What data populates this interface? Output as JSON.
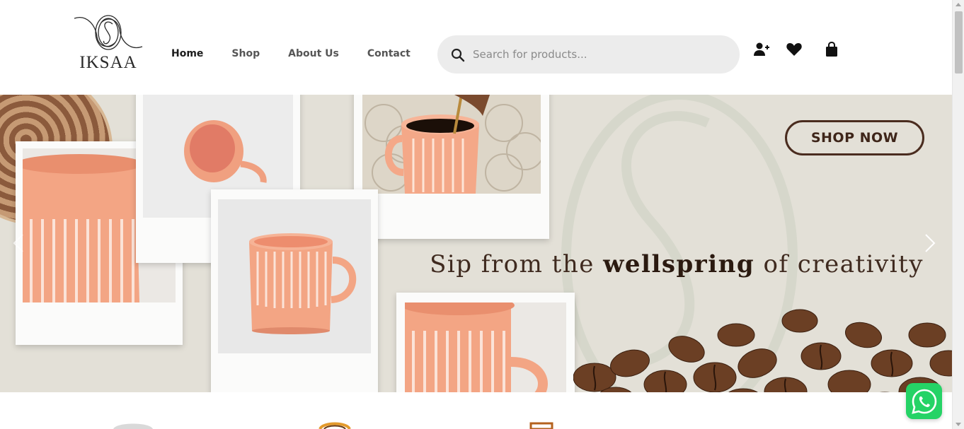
{
  "brand": {
    "name": "IKSAA"
  },
  "nav": {
    "items": [
      "Home",
      "Shop",
      "About Us",
      "Contact"
    ],
    "active": "Home"
  },
  "search": {
    "placeholder": "Search for products..."
  },
  "header_icons": [
    "add-user-icon",
    "heart-icon",
    "shopping-bag-icon"
  ],
  "hero": {
    "cta_label": "SHOP NOW",
    "tagline_pre": "Sip from the ",
    "tagline_bold": "wellspring",
    "tagline_post": " of creativity"
  },
  "colors": {
    "hero_bg": "#e3e0d7",
    "accent_brown": "#3e2519",
    "mug_peach": "#f2a07a",
    "whatsapp": "#25d366"
  }
}
